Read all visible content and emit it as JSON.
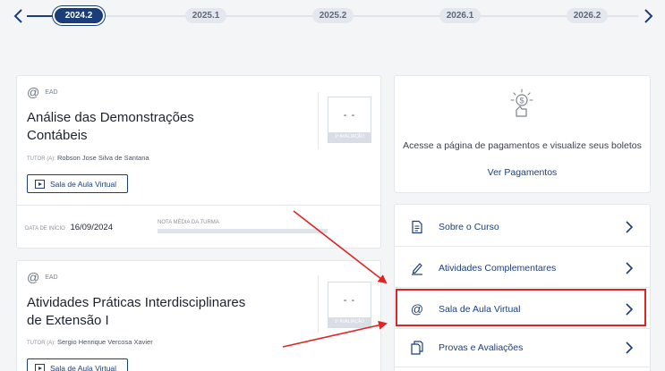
{
  "timeline": {
    "periods": [
      "2024.2",
      "2025.1",
      "2025.2",
      "2026.1",
      "2026.2"
    ],
    "active_period": "2024.2"
  },
  "courses": [
    {
      "modality": "EAD",
      "title_line1": "Análise das Demonstrações",
      "title_line2": "Contábeis",
      "tutor_label": "TUTOR (A):",
      "tutor_name": "Robson Jose Silva de Santana",
      "virtual_button": "Sala de Aula Virtual",
      "grade_value": "- -",
      "grade_label": "1ª AVALIAÇÃO",
      "start_label": "DATA DE INÍCIO",
      "start_date": "16/09/2024",
      "avg_label": "NOTA MÉDIA DA TURMA"
    },
    {
      "modality": "EAD",
      "title_line1": "Atividades Práticas Interdisciplinares",
      "title_line2": "de Extensão I",
      "tutor_label": "TUTOR (A):",
      "tutor_name": "Sergio Henrique Vercosa Xavier",
      "virtual_button": "Sala de Aula Virtual",
      "grade_value": "- -",
      "grade_label": "1ª AVALIAÇÃO"
    }
  ],
  "payments": {
    "icon": "payment-hand-icon",
    "text": "Acesse a página de pagamentos e visualize seus boletos",
    "link": "Ver Pagamentos"
  },
  "menu": {
    "items": [
      {
        "label": "Sobre o Curso",
        "icon": "document-icon"
      },
      {
        "label": "Atividades Complementares",
        "icon": "pen-icon"
      },
      {
        "label": "Sala de Aula Virtual",
        "icon": "at-icon"
      },
      {
        "label": "Provas e Avaliações",
        "icon": "copy-icon"
      }
    ]
  },
  "colors": {
    "primary": "#1b3e7a",
    "highlight": "#e02424",
    "background": "#f4f5f7"
  }
}
